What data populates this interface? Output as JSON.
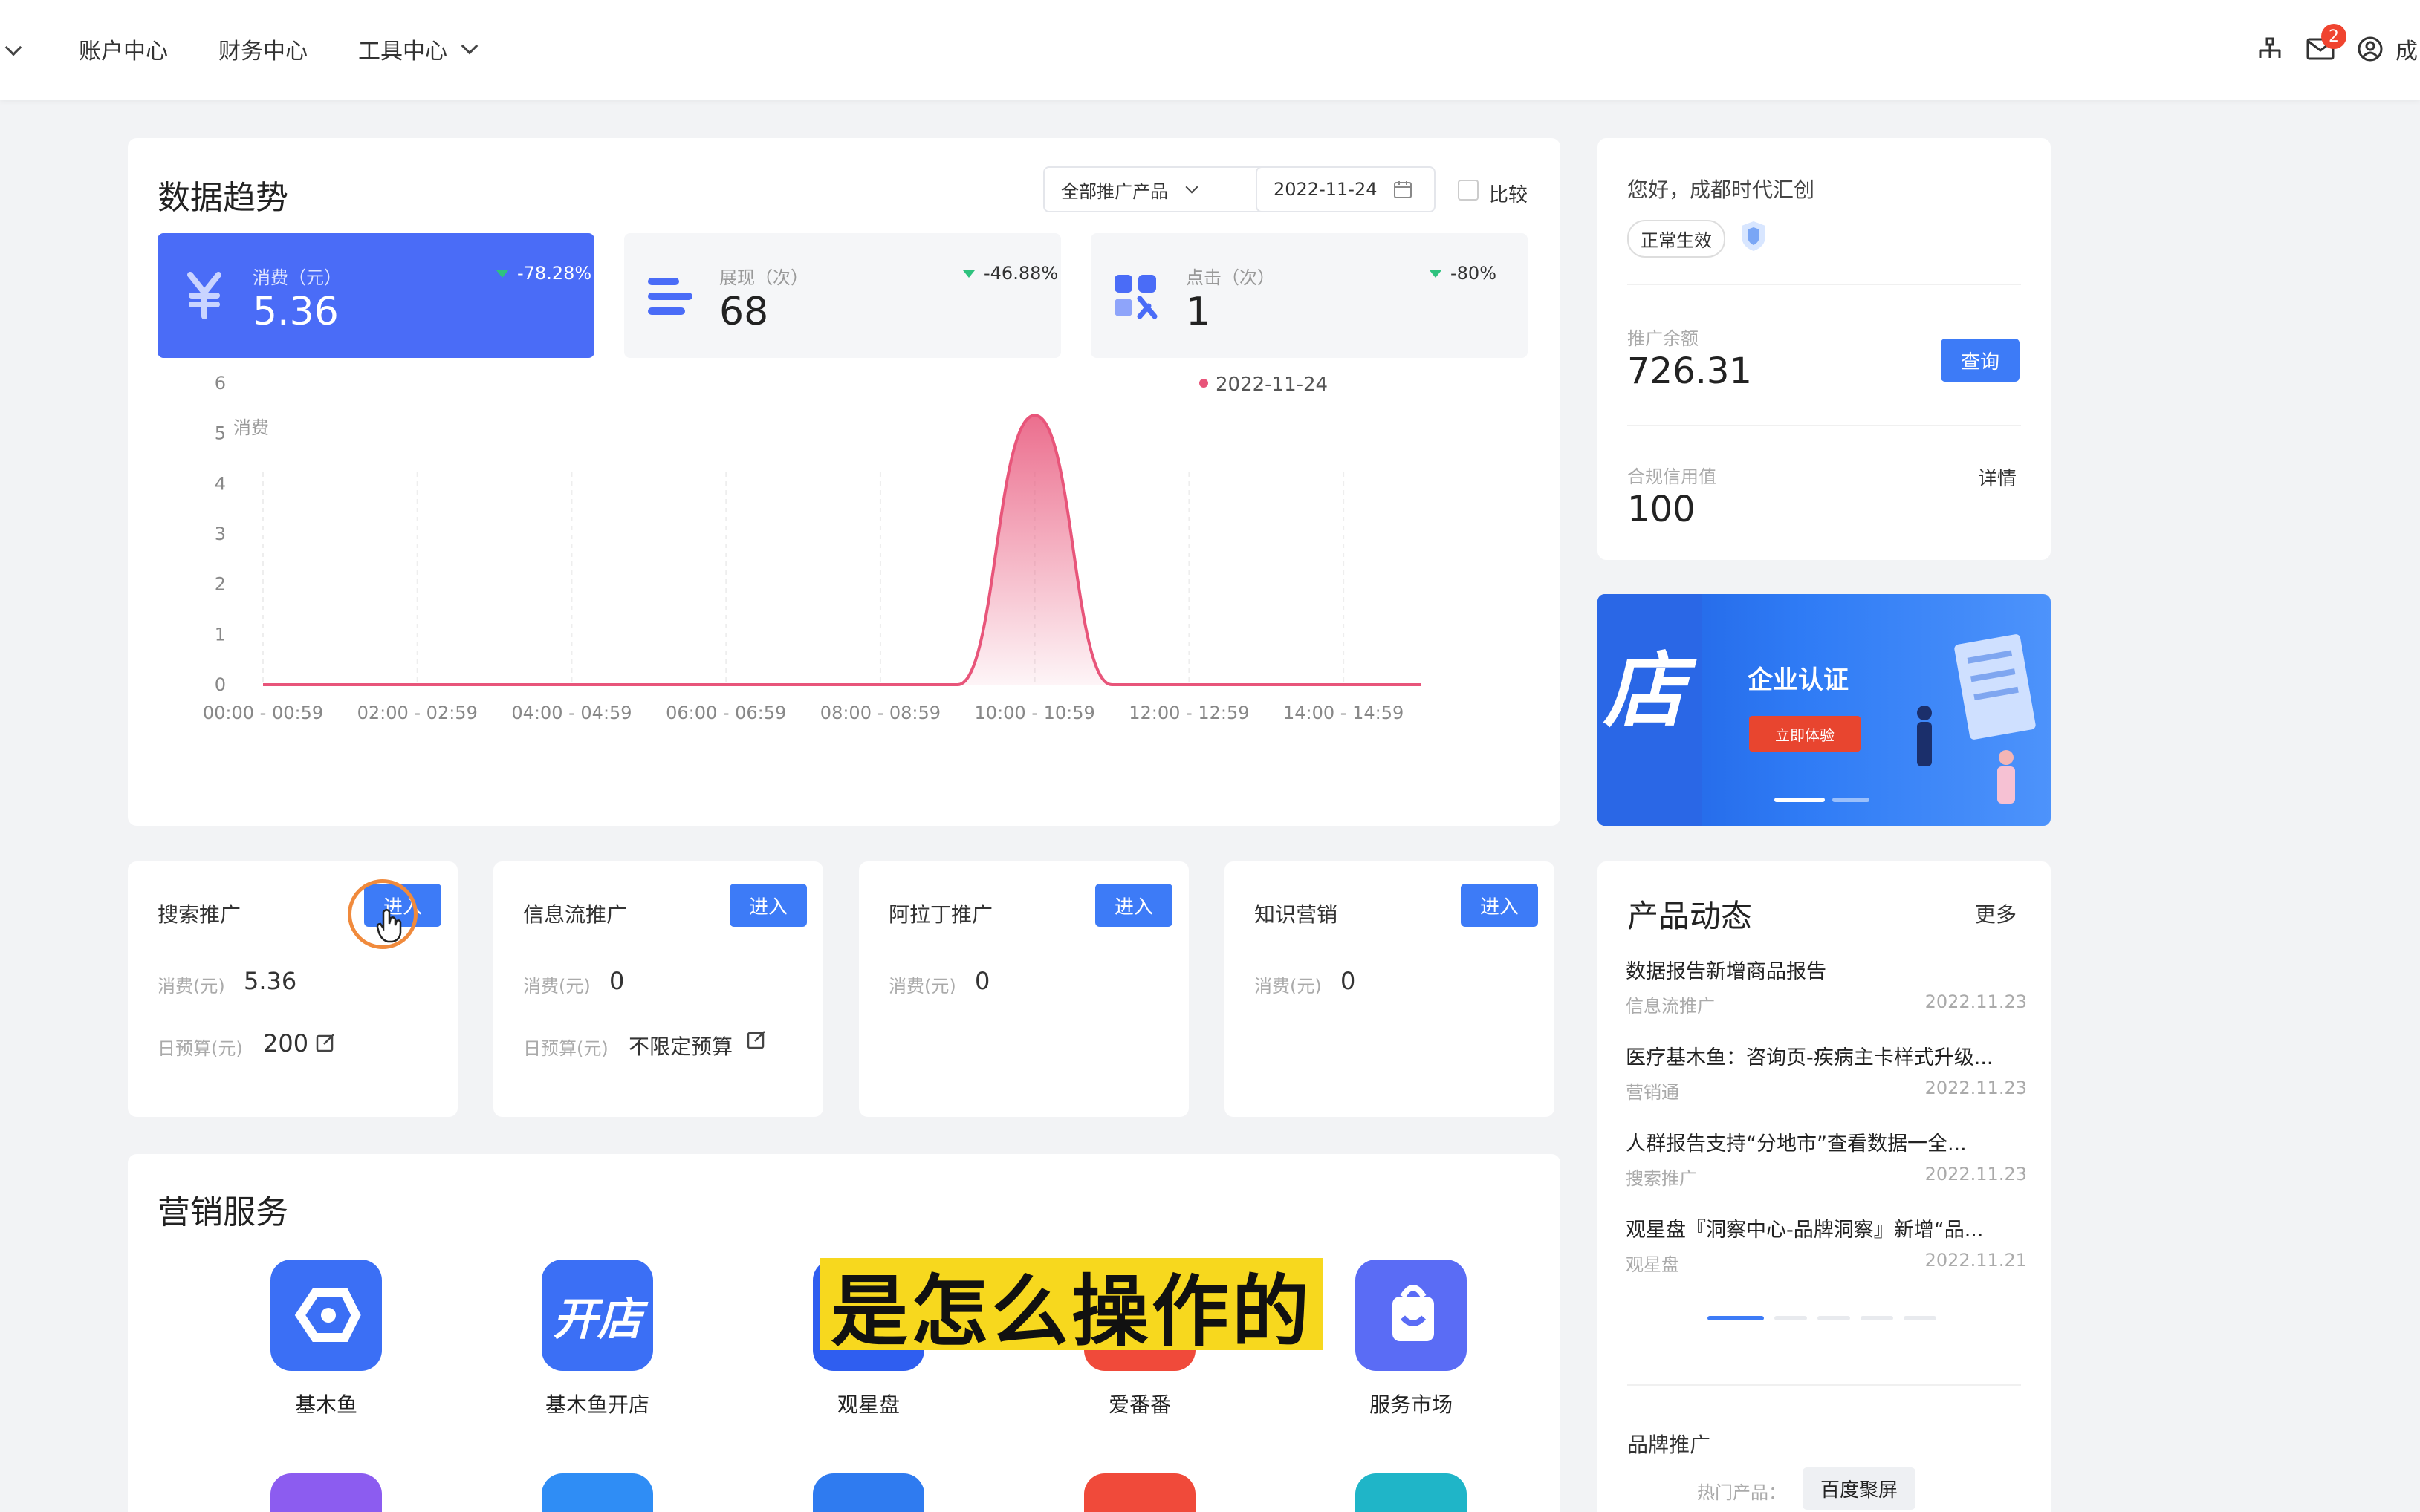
{
  "nav": {
    "items": [
      "账户中心",
      "财务中心",
      "工具中心"
    ],
    "notification_count": "2",
    "user_initial": "成"
  },
  "trend": {
    "title": "数据趋势",
    "product_select": "全部推广产品",
    "date": "2022-11-24",
    "compare_label": "比较",
    "stats": [
      {
        "label": "消费（元）",
        "value": "5.36",
        "change": "-78.28%"
      },
      {
        "label": "展现（次）",
        "value": "68",
        "change": "-46.88%"
      },
      {
        "label": "点击（次）",
        "value": "1",
        "change": "-80%"
      }
    ]
  },
  "chart_data": {
    "type": "area",
    "ylabel": "消费",
    "legend": "2022-11-24",
    "legend_color": "#e8557a",
    "yticks": [
      0,
      1,
      2,
      3,
      4,
      5,
      6
    ],
    "ylim": [
      0,
      6
    ],
    "xtick_labels": [
      "00:00 - 00:59",
      "02:00 - 02:59",
      "04:00 - 04:59",
      "06:00 - 06:59",
      "08:00 - 08:59",
      "10:00 - 10:59",
      "12:00 - 12:59",
      "14:00 - 14:59"
    ],
    "x": [
      0,
      1,
      2,
      3,
      4,
      5,
      6,
      7,
      8,
      9,
      10,
      11,
      12,
      13,
      14,
      15
    ],
    "values": [
      0,
      0,
      0,
      0,
      0,
      0,
      0,
      0,
      0,
      0,
      5.36,
      0,
      0,
      0,
      0,
      0
    ],
    "grid": "vertical dashed"
  },
  "account": {
    "greeting": "您好，成都时代汇创",
    "status": "正常生效",
    "balance_label": "推广余额",
    "balance": "726.31",
    "query_btn": "查询",
    "credit_label": "合规信用值",
    "credit": "100",
    "detail_link": "详情"
  },
  "banner": {
    "title": "企业认证",
    "cta": "立即体验",
    "side_text": "店"
  },
  "promos": [
    {
      "title": "搜索推广",
      "enter": "进入",
      "spend_label": "消费(元)",
      "spend": "5.36",
      "budget_label": "日预算(元)",
      "budget": "200"
    },
    {
      "title": "信息流推广",
      "enter": "进入",
      "spend_label": "消费(元)",
      "spend": "0",
      "budget_label": "日预算(元)",
      "budget": "不限定预算"
    },
    {
      "title": "阿拉丁推广",
      "enter": "进入",
      "spend_label": "消费(元)",
      "spend": "0"
    },
    {
      "title": "知识营销",
      "enter": "进入",
      "spend_label": "消费(元)",
      "spend": "0"
    }
  ],
  "news": {
    "title": "产品动态",
    "more": "更多",
    "items": [
      {
        "title": "数据报告新增商品报告",
        "tag": "信息流推广",
        "date": "2022.11.23"
      },
      {
        "title": "医疗基木鱼：咨询页-疾病主卡样式升级...",
        "tag": "营销通",
        "date": "2022.11.23"
      },
      {
        "title": "人群报告支持“分地市”查看数据一全...",
        "tag": "搜索推广",
        "date": "2022.11.23"
      },
      {
        "title": "观星盘『洞察中心-品牌洞察』新增“品...",
        "tag": "观星盘",
        "date": "2022.11.21"
      }
    ]
  },
  "brand": {
    "title": "品牌推广",
    "hot_label": "热门产品：",
    "hot_value": "百度聚屏"
  },
  "services": {
    "title": "营销服务",
    "items": [
      {
        "label": "基木鱼",
        "color": "#3b6ff5"
      },
      {
        "label": "基木鱼开店",
        "color": "#3b6ff5"
      },
      {
        "label": "观星盘",
        "color": "#2f5ef0"
      },
      {
        "label": "爱番番",
        "color": "#f04a3a"
      },
      {
        "label": "服务市场",
        "color": "#5a6cf5"
      }
    ],
    "row2_colors": [
      "#8c5cf0",
      "#2f8df5",
      "#2f7bf0",
      "#f04a3a",
      "#1fb5c8"
    ]
  },
  "subtitle": "是怎么操作的"
}
